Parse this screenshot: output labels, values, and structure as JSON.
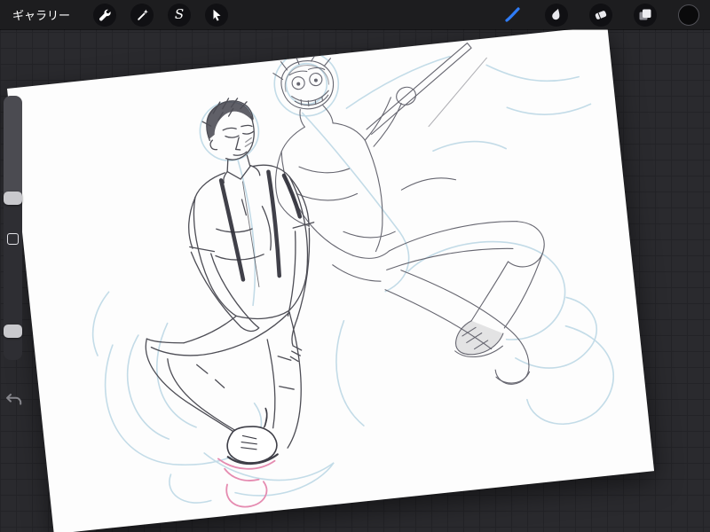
{
  "topbar": {
    "gallery_label": "ギャラリー",
    "selection_glyph": "S",
    "accent_color": "#2f7cf6",
    "left_tools": [
      {
        "id": "actions",
        "icon": "wrench-icon"
      },
      {
        "id": "adjustments",
        "icon": "magic-wand-icon"
      },
      {
        "id": "selection",
        "icon": "selection-s-icon"
      },
      {
        "id": "transform",
        "icon": "transform-arrow-icon"
      }
    ],
    "right_tools": [
      {
        "id": "paint",
        "icon": "brush-icon",
        "active": true
      },
      {
        "id": "smudge",
        "icon": "smudge-icon"
      },
      {
        "id": "erase",
        "icon": "eraser-icon"
      },
      {
        "id": "layers",
        "icon": "layers-icon"
      },
      {
        "id": "color",
        "icon": "color-swatch-icon",
        "swatch_color": "#0a0a0b"
      }
    ]
  },
  "sidebar": {
    "sliders": [
      {
        "id": "brush-size"
      },
      {
        "id": "opacity"
      }
    ],
    "has_modify_button": true,
    "undo_icon": "undo-arrow-icon"
  },
  "canvas": {
    "rotation_deg": -6,
    "paper_color": "#fdfdfd",
    "content": "pencil sketch of two figures, one tying a shoe, one holding a pole",
    "sketch_colors": {
      "graphite": "#4d4d55",
      "underlay_cyan": "#b9d6e4",
      "accent_pink": "#e58bb0"
    }
  }
}
